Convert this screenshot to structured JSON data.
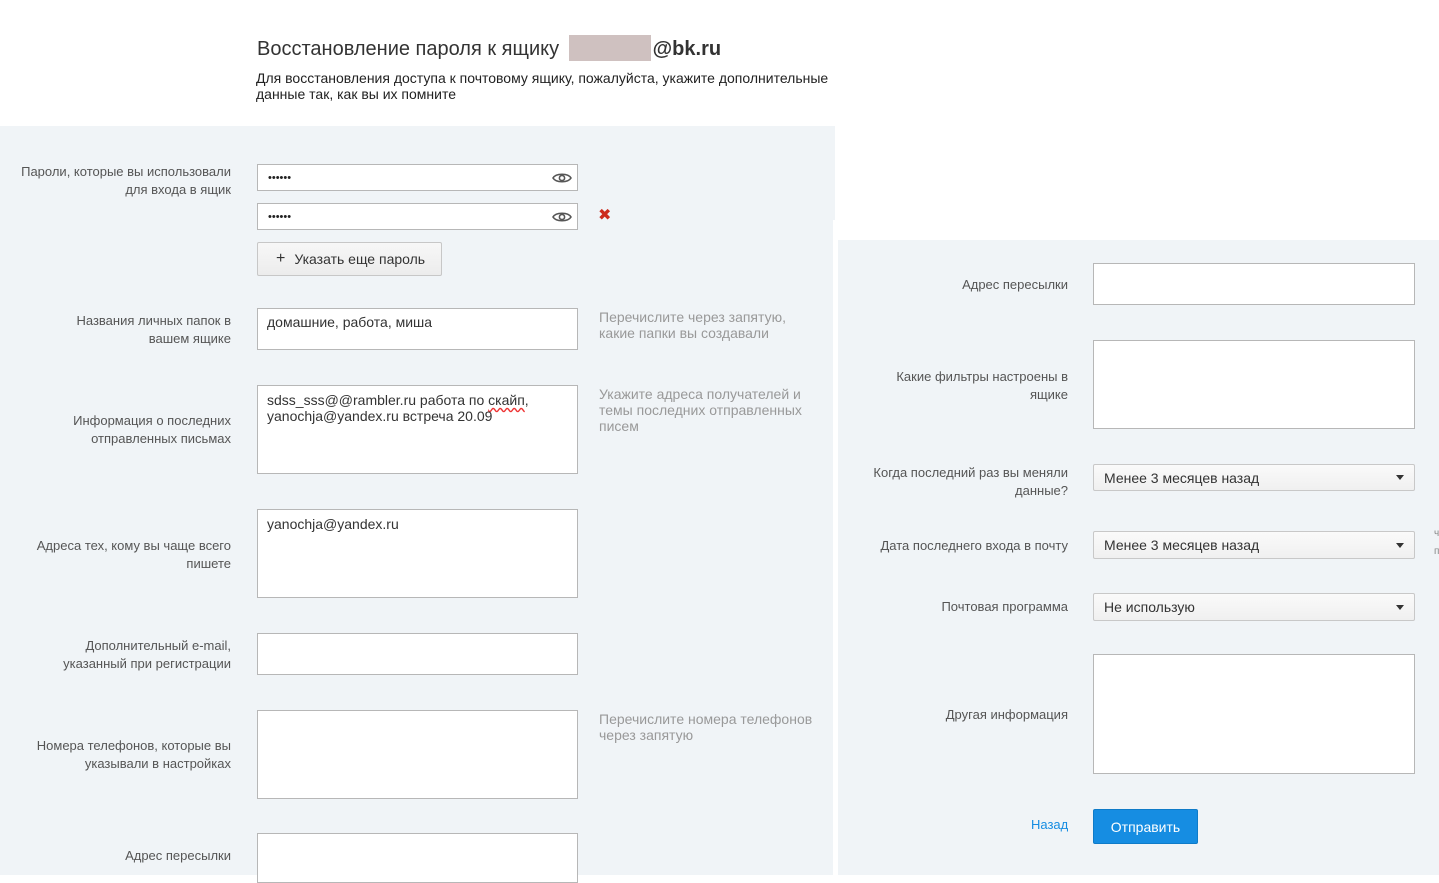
{
  "header": {
    "title": "Восстановление пароля к ящику",
    "domain": "@bk.ru",
    "subtitle": "Для восстановления доступа к почтовому ящику, пожалуйста, укажите дополнительные данные так, как вы их помните"
  },
  "left": {
    "passwords": {
      "label": "Пароли, которые вы использовали для входа в ящик",
      "values": [
        "••••••",
        "••••••"
      ],
      "add_button": "Указать еще пароль"
    },
    "folders": {
      "label": "Названия личных папок в вашем ящике",
      "value": "домашние, работа, миша",
      "hint": "Перечислите через запятую, какие папки вы создавали"
    },
    "last_letters": {
      "label": "Информация о последних отправленных письмах",
      "value_line1_prefix": "sdss_sss@@rambler.ru работа по ",
      "value_line1_word": "скайп",
      "value_line1_suffix": ",",
      "value_line2": "yanochja@yandex.ru встреча 20.09",
      "hint": "Укажите адреса получателей и темы последних отправленных писем"
    },
    "frequent": {
      "label": "Адреса тех, кому вы чаще всего пишете",
      "value": "yanochja@yandex.ru"
    },
    "extra_email": {
      "label": "Дополнительный e-mail, указанный при регистрации",
      "value": ""
    },
    "phones": {
      "label": "Номера телефонов, которые вы указывали в настройках",
      "value": "",
      "hint": "Перечислите номера телефонов через запятую"
    },
    "forward": {
      "label": "Адрес пересылки",
      "value": ""
    }
  },
  "right": {
    "forward": {
      "label": "Адрес пересылки",
      "value": ""
    },
    "filters": {
      "label": "Какие фильтры настроены в ящике",
      "value": ""
    },
    "last_change": {
      "label": "Когда последний раз вы меняли данные?",
      "selected": "Менее 3 месяцев назад"
    },
    "last_login": {
      "label": "Дата последнего входа в почту",
      "selected": "Менее 3 месяцев назад"
    },
    "mail_client": {
      "label": "Почтовая программа",
      "selected": "Не использую"
    },
    "other": {
      "label": "Другая информация",
      "value": ""
    },
    "back_link": "Назад",
    "submit": "Отправить"
  },
  "colors": {
    "panel_bg": "#f0f4f7",
    "accent": "#168de2",
    "remove": "#cc2a1d"
  },
  "icons": [
    "eye-icon",
    "close-icon",
    "plus-icon",
    "chevron-down-icon"
  ]
}
